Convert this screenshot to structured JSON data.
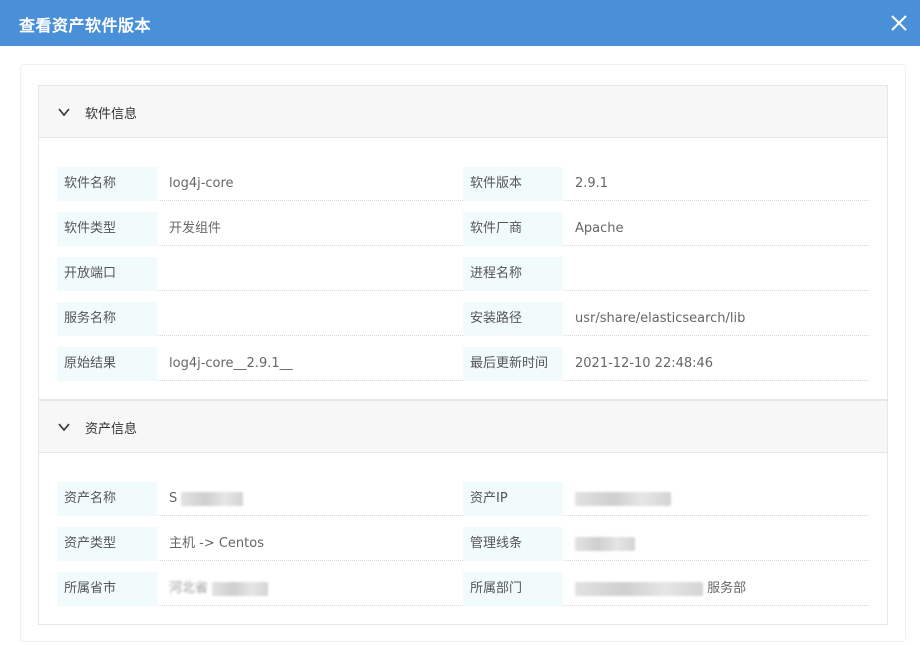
{
  "dialog": {
    "title": "查看资产软件版本"
  },
  "software": {
    "section_title": "软件信息",
    "fields": [
      {
        "label": "软件名称",
        "value": "log4j-core"
      },
      {
        "label": "软件版本",
        "value": "2.9.1"
      },
      {
        "label": "软件类型",
        "value": "开发组件"
      },
      {
        "label": "软件厂商",
        "value": "Apache"
      },
      {
        "label": "开放端口",
        "value": ""
      },
      {
        "label": "进程名称",
        "value": ""
      },
      {
        "label": "服务名称",
        "value": ""
      },
      {
        "label": "安装路径",
        "value": "usr/share/elasticsearch/lib"
      },
      {
        "label": "原始结果",
        "value": "log4j-core__2.9.1__"
      },
      {
        "label": "最后更新时间",
        "value": "2021-12-10 22:48:46"
      }
    ]
  },
  "asset": {
    "section_title": "资产信息",
    "fields": [
      {
        "label": "资产名称",
        "value": "S"
      },
      {
        "label": "资产IP",
        "value": ""
      },
      {
        "label": "资产类型",
        "value": "主机 -> Centos"
      },
      {
        "label": "管理线条",
        "value": ""
      },
      {
        "label": "所属省市",
        "value": "河北省"
      },
      {
        "label": "所属部门",
        "value": "服务部"
      }
    ]
  },
  "icons": {
    "close": "close-icon",
    "chevron": "chevron-down-icon"
  },
  "colors": {
    "titlebar": "#4a90d9",
    "label_bg": "#f2fbfc"
  }
}
